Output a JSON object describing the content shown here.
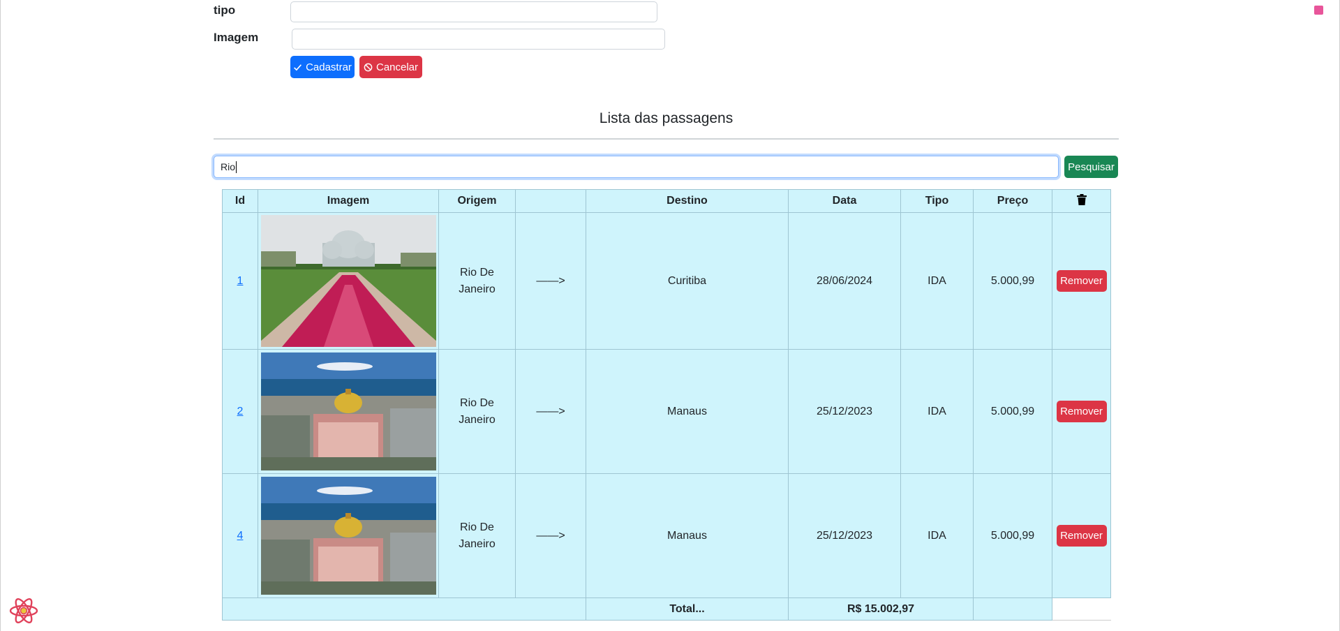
{
  "form": {
    "tipo_label": "tipo",
    "imagem_label": "Imagem",
    "tipo_value": "",
    "imagem_value": "",
    "cadastrar_label": "Cadastrar",
    "cancelar_label": "Cancelar"
  },
  "list": {
    "title": "Lista das passagens",
    "search_value": "Rio",
    "search_button": "Pesquisar"
  },
  "table": {
    "headers": {
      "id": "Id",
      "imagem": "Imagem",
      "origem": "Origem",
      "arrow": "",
      "destino": "Destino",
      "data": "Data",
      "tipo": "Tipo",
      "preco": "Preço"
    },
    "rows": [
      {
        "id": "1",
        "image": "curitiba-botanical-garden",
        "origem": "Rio De Janeiro",
        "arrow": "——>",
        "destino": "Curitiba",
        "data": "28/06/2024",
        "tipo": "IDA",
        "preco": "5.000,99",
        "remove": "Remover"
      },
      {
        "id": "2",
        "image": "manaus-theatre",
        "origem": "Rio De Janeiro",
        "arrow": "——>",
        "destino": "Manaus",
        "data": "25/12/2023",
        "tipo": "IDA",
        "preco": "5.000,99",
        "remove": "Remover"
      },
      {
        "id": "4",
        "image": "manaus-theatre",
        "origem": "Rio De Janeiro",
        "arrow": "——>",
        "destino": "Manaus",
        "data": "25/12/2023",
        "tipo": "IDA",
        "preco": "5.000,99",
        "remove": "Remover"
      }
    ],
    "footer": {
      "total_label": "Total...",
      "total_value": "R$ 15.002,97"
    }
  },
  "colors": {
    "primary": "#0d6efd",
    "danger": "#dc3545",
    "success": "#198754",
    "table_bg": "#cff4fc"
  },
  "icons": {
    "trash": "trash-icon",
    "check": "check-icon",
    "cancel": "ban-icon",
    "react": "react-devtools-icon"
  }
}
